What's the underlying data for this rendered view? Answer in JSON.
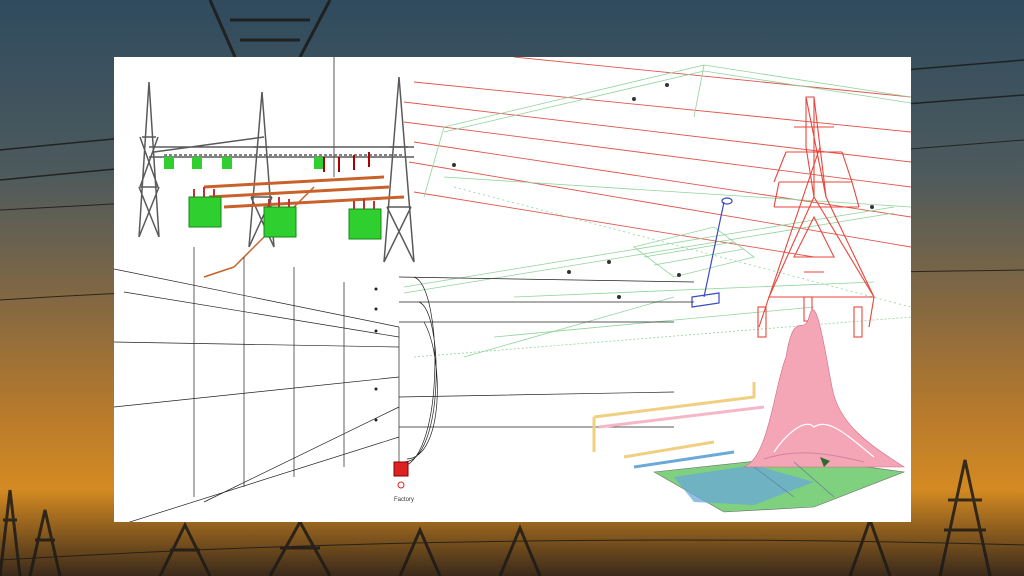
{
  "scene": {
    "diagram_label": "Factory",
    "colors": {
      "sky_top": "#2f4b5e",
      "sky_mid": "#b87a2c",
      "tower_dark": "#1c1a18",
      "steel_gray": "#5a5a5a",
      "transformer_green": "#2ecf2e",
      "bus_orange": "#c9622a",
      "wire_red": "#e0564e",
      "wire_green": "#8fd49a",
      "lattice_red": "#e8463c",
      "surface_pink": "#f4a6b6"
    }
  }
}
